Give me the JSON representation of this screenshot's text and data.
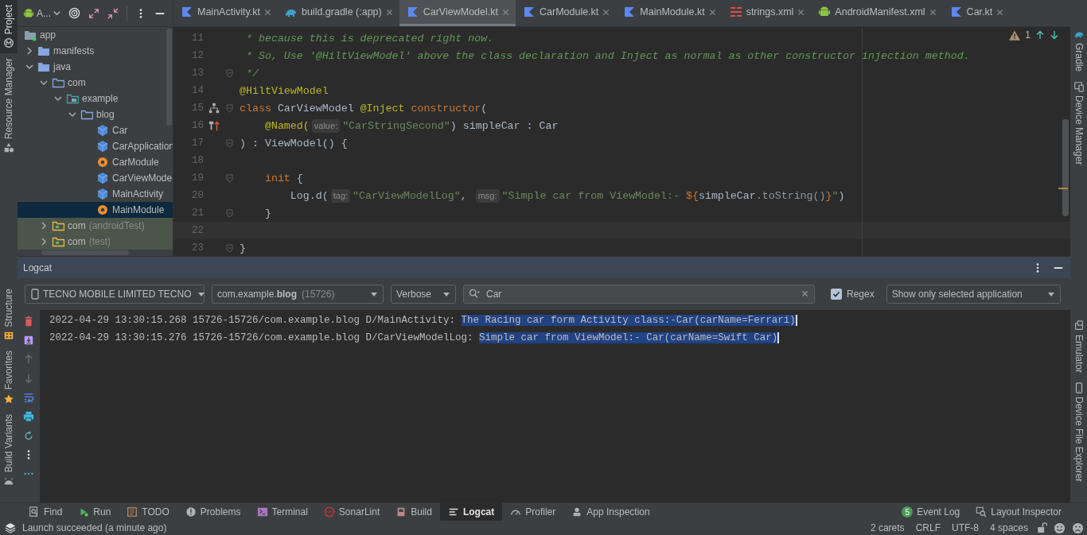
{
  "left_tool_strip": {
    "top": [
      {
        "label": "Project",
        "kind": "project",
        "selected": true
      },
      {
        "label": "Resource Manager",
        "kind": "resources",
        "selected": false
      }
    ],
    "bottom": [
      {
        "label": "Structure",
        "kind": "structure",
        "selected": false
      },
      {
        "label": "Favorites",
        "kind": "favorites",
        "selected": false
      },
      {
        "label": "Build Variants",
        "kind": "variants",
        "selected": false
      }
    ]
  },
  "right_tool_strip": {
    "top": [
      {
        "label": "Gradle",
        "kind": "gradle",
        "selected": false
      },
      {
        "label": "Device Manager",
        "kind": "devices",
        "selected": false
      }
    ],
    "bottom": [
      {
        "label": "Emulator",
        "kind": "emulator",
        "selected": false
      },
      {
        "label": "Device File Explorer",
        "kind": "files",
        "selected": false
      }
    ]
  },
  "project_panel": {
    "view_selector": "A...",
    "tree": [
      {
        "label": "app",
        "kind": "module",
        "selected": false,
        "children": [
          {
            "label": "manifests",
            "kind": "folder",
            "expanded": false,
            "selected": false
          },
          {
            "label": "java",
            "kind": "folder",
            "expanded": true,
            "selected": false,
            "children": [
              {
                "label": "com",
                "kind": "package",
                "expanded": true,
                "selected": false,
                "children": [
                  {
                    "label": "example",
                    "kind": "res_package",
                    "expanded": true,
                    "selected": false,
                    "children": [
                      {
                        "label": "blog",
                        "kind": "package",
                        "expanded": true,
                        "selected": false,
                        "children": [
                          {
                            "label": "Car",
                            "kind": "class",
                            "selected": false
                          },
                          {
                            "label": "CarApplication",
                            "kind": "class",
                            "selected": false
                          },
                          {
                            "label": "CarModule",
                            "kind": "object",
                            "selected": false
                          },
                          {
                            "label": "CarViewModel",
                            "kind": "class",
                            "selected": false
                          },
                          {
                            "label": "MainActivity",
                            "kind": "class",
                            "selected": false
                          },
                          {
                            "label": "MainModule",
                            "kind": "object",
                            "selected": true
                          }
                        ]
                      }
                    ]
                  }
                ]
              },
              {
                "label": "com",
                "note": "(androidTest)",
                "kind": "test_package",
                "expanded": false,
                "selected": false
              },
              {
                "label": "com",
                "note": "(test)",
                "kind": "test_package",
                "expanded": false,
                "selected": false
              }
            ]
          }
        ]
      }
    ]
  },
  "editor": {
    "tabs": [
      {
        "label": "MainActivity.kt",
        "kind": "kotlin",
        "selected": false
      },
      {
        "label": "build.gradle (:app)",
        "kind": "gradle",
        "selected": false
      },
      {
        "label": "CarViewModel.kt",
        "kind": "kotlin",
        "selected": true
      },
      {
        "label": "CarModule.kt",
        "kind": "kotlin",
        "selected": false
      },
      {
        "label": "MainModule.kt",
        "kind": "kotlin",
        "selected": false
      },
      {
        "label": "strings.xml",
        "kind": "values",
        "selected": false
      },
      {
        "label": "AndroidManifest.xml",
        "kind": "manifest",
        "selected": false
      },
      {
        "label": "Car.kt",
        "kind": "kotlin",
        "selected": false
      }
    ],
    "warning_count": "1",
    "lines": [
      {
        "number": "11",
        "fold": false,
        "current": false,
        "segments": [
          {
            "kind": "comment",
            "text": " * because this is deprecated right now."
          }
        ]
      },
      {
        "number": "12",
        "fold": false,
        "current": false,
        "segments": [
          {
            "kind": "comment",
            "text": " * So, Use '@HiltViewModel' above the class declaration and Inject as normal as other constructor injection method."
          }
        ]
      },
      {
        "number": "13",
        "fold": true,
        "current": false,
        "segments": [
          {
            "kind": "comment",
            "text": " */"
          }
        ]
      },
      {
        "number": "14",
        "fold": false,
        "current": false,
        "segments": [
          {
            "kind": "annotation",
            "text": "@HiltViewModel"
          }
        ]
      },
      {
        "number": "15",
        "fold": true,
        "current": false,
        "gutter": {
          "kind": "hierarchy"
        },
        "segments": [
          {
            "kind": "keyword",
            "text": "class "
          },
          {
            "kind": "plain",
            "text": "CarViewModel "
          },
          {
            "kind": "annotation",
            "text": "@Inject "
          },
          {
            "kind": "keyword",
            "text": "constructor"
          },
          {
            "kind": "plain",
            "text": "("
          }
        ]
      },
      {
        "number": "16",
        "fold": false,
        "current": false,
        "gutter": {
          "kind": "injection"
        },
        "segments": [
          {
            "kind": "annotation",
            "text": "    @Named("
          },
          {
            "kind": "hint",
            "text": "value:"
          },
          {
            "kind": "string",
            "text": "\"CarStringSecond\""
          },
          {
            "kind": "plain",
            "text": ") simpleCar : Car"
          }
        ]
      },
      {
        "number": "17",
        "fold": true,
        "current": false,
        "segments": [
          {
            "kind": "plain",
            "text": ") : ViewModel() {"
          }
        ]
      },
      {
        "number": "18",
        "fold": false,
        "current": false
      },
      {
        "number": "19",
        "fold": true,
        "current": false,
        "segments": [
          {
            "kind": "keyword",
            "text": "    init"
          },
          {
            "kind": "plain",
            "text": " {"
          }
        ]
      },
      {
        "number": "20",
        "fold": false,
        "current": false,
        "segments": [
          {
            "kind": "plain",
            "text": "        Log.d("
          },
          {
            "kind": "hint",
            "text": "tag:"
          },
          {
            "kind": "string",
            "text": "\"CarViewModelLog\""
          },
          {
            "kind": "plain",
            "text": ", "
          },
          {
            "kind": "hint",
            "text": "msg:"
          },
          {
            "kind": "string",
            "text": "\"Simple car from ViewModel:- "
          },
          {
            "kind": "template",
            "text": "${"
          },
          {
            "kind": "plain",
            "text": "simpleCar"
          },
          {
            "kind": "call",
            "text": ".toString()"
          },
          {
            "kind": "template",
            "text": "}"
          },
          {
            "kind": "string",
            "text": "\""
          },
          {
            "kind": "plain",
            "text": ")"
          }
        ]
      },
      {
        "number": "21",
        "fold": true,
        "current": false,
        "segments": [
          {
            "kind": "plain",
            "text": "    }"
          }
        ]
      },
      {
        "number": "22",
        "fold": false,
        "current": true
      },
      {
        "number": "23",
        "fold": true,
        "current": false,
        "segments": [
          {
            "kind": "plain",
            "text": "}"
          }
        ]
      }
    ]
  },
  "logcat": {
    "title": "Logcat",
    "device": "TECNO MOBILE LIMITED TECNO",
    "process": "com.example.**blog**",
    "process_id": "(15726)",
    "level": "Verbose",
    "search": {
      "value": "Car"
    },
    "regex": {
      "label": "Regex",
      "checked": true
    },
    "filter": "Show only selected application",
    "side_tools": [
      {
        "kind": "clear",
        "disabled": false
      },
      {
        "kind": "scroll_end",
        "disabled": false
      },
      {
        "kind": "up",
        "disabled": true
      },
      {
        "kind": "down",
        "disabled": true
      },
      {
        "kind": "wrap",
        "disabled": false
      },
      {
        "kind": "print",
        "disabled": false
      },
      {
        "kind": "restart",
        "disabled": false
      },
      {
        "kind": "options",
        "disabled": false
      },
      {
        "kind": "more",
        "disabled": false
      }
    ],
    "lines": [
      {
        "text": "2022-04-29 13:30:15.268 15726-15726/com.example.blog D/MainActivity: ",
        "selection": "The Racing car form Activity class:-Car(carName=Ferrari)"
      },
      {
        "text": "2022-04-29 13:30:15.276 15726-15726/com.example.blog D/CarViewModelLog: ",
        "selection": "Simple car from ViewModel:- Car(carName=Swift Car)"
      }
    ]
  },
  "bottom_tool_tabs": {
    "left": [
      {
        "label": "Find",
        "kind": "find",
        "selected": false
      },
      {
        "label": "Run",
        "kind": "run",
        "selected": false
      },
      {
        "label": "TODO",
        "kind": "todo",
        "selected": false
      },
      {
        "label": "Problems",
        "kind": "problems",
        "selected": false
      },
      {
        "label": "Terminal",
        "kind": "terminal",
        "selected": false
      },
      {
        "label": "SonarLint",
        "kind": "sonar",
        "selected": false
      },
      {
        "label": "Build",
        "kind": "build",
        "selected": false
      },
      {
        "label": "Logcat",
        "kind": "logcat",
        "selected": true
      },
      {
        "label": "Profiler",
        "kind": "profiler",
        "selected": false
      },
      {
        "label": "App Inspection",
        "kind": "inspection",
        "selected": false
      }
    ],
    "right": [
      {
        "label": "Event Log",
        "kind": "events",
        "selected": false,
        "badge": "5"
      },
      {
        "label": "Layout Inspector",
        "kind": "layout",
        "selected": false
      }
    ]
  },
  "status_bar": {
    "message": "Launch succeeded (a minute ago)",
    "items": [
      "2 carets",
      "CRLF",
      "UTF-8",
      "4 spaces"
    ]
  }
}
